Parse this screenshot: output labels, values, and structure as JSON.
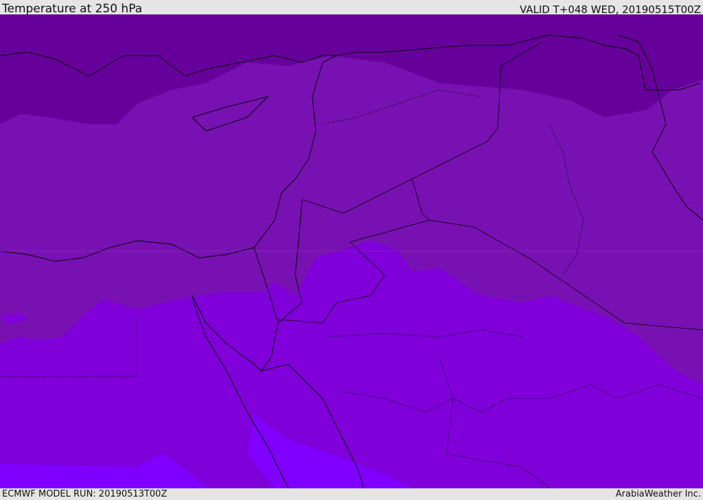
{
  "header": {
    "title": "Temperature at 250 hPa",
    "valid": "VALID T+048 WED, 20190515T00Z"
  },
  "footer": {
    "model_run": "ECMWF MODEL RUN: 20190513T00Z",
    "credit": "ArabiaWeather Inc."
  },
  "colors": {
    "band_coldest": "#66009a",
    "band_cold": "#7811b2",
    "band_mid": "#7e00d9",
    "band_warm": "#7f00ff",
    "border": "#000000"
  }
}
